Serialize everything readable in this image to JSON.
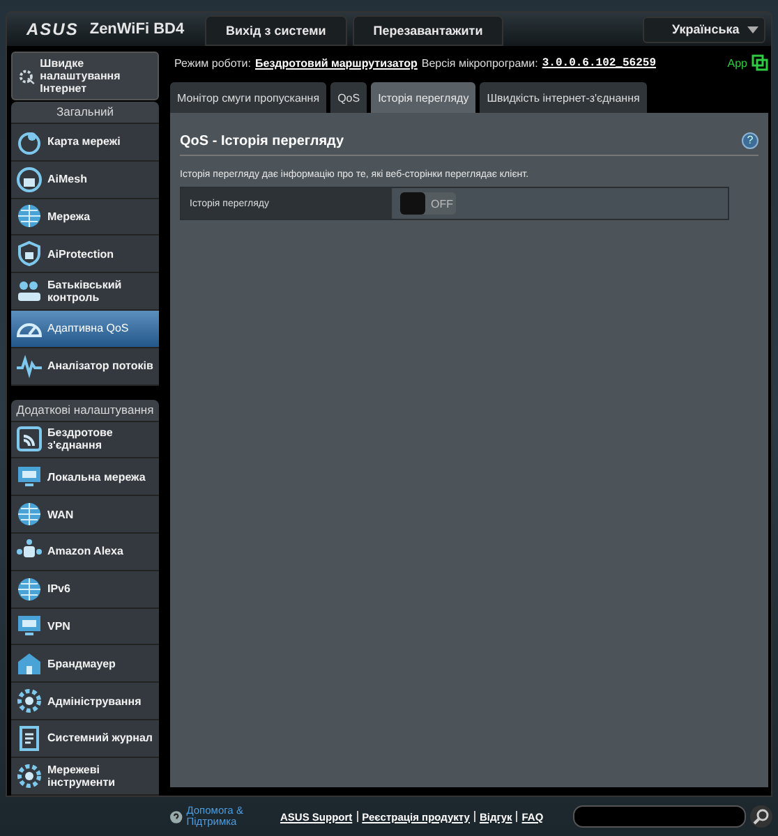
{
  "header": {
    "logo": "ASUS",
    "model": "ZenWiFi BD4",
    "buttons": [
      "Вихід з системи",
      "Перезавантажити"
    ],
    "language": "Українська"
  },
  "status": {
    "mode_label": "Режим роботи:",
    "mode": "Бездротовий маршрутизатор",
    "firmware_label": "Версія мікропрограми:",
    "firmware": "3.0.0.6.102_56259",
    "app": "App"
  },
  "quick_setup": "Швидке налаштування Інтернет",
  "sections": [
    {
      "title": "Загальний",
      "items": [
        {
          "label": "Карта мережі",
          "selected": false
        },
        {
          "label": "AiMesh",
          "selected": false
        },
        {
          "label": "Мережа",
          "selected": false
        },
        {
          "label": "AiProtection",
          "selected": false
        },
        {
          "label": "Батьківський контроль",
          "selected": false
        },
        {
          "label": "Адаптивна QoS",
          "selected": true
        },
        {
          "label": "Аналізатор потоків",
          "selected": false
        }
      ]
    },
    {
      "title": "Додаткові налаштування",
      "items": [
        {
          "label": "Бездротове з'єднання",
          "selected": false
        },
        {
          "label": "Локальна мережа",
          "selected": false
        },
        {
          "label": "WAN",
          "selected": false
        },
        {
          "label": "Amazon Alexa",
          "selected": false
        },
        {
          "label": "IPv6",
          "selected": false
        },
        {
          "label": "VPN",
          "selected": false
        },
        {
          "label": "Брандмауер",
          "selected": false
        },
        {
          "label": "Адміністрування",
          "selected": false
        },
        {
          "label": "Системний журнал",
          "selected": false
        },
        {
          "label": "Мережеві інструменти",
          "selected": false
        }
      ]
    }
  ],
  "tabs": [
    {
      "label": "Монітор смуги пропускання",
      "selected": false
    },
    {
      "label": "QoS",
      "selected": false
    },
    {
      "label": "Історія перегляду",
      "selected": true
    },
    {
      "label": "Швидкість інтернет-з'єднання",
      "selected": false
    }
  ],
  "panel": {
    "title": "QoS - Історія перегляду",
    "help": "?",
    "description": "Історія перегляду дає інформацію про те, які веб-сторінки переглядає клієнт.",
    "settings": [
      {
        "label": "Історія перегляду",
        "on": false,
        "state_text": "OFF"
      }
    ]
  },
  "footer": {
    "help": "Допомога & Підтримка",
    "links": [
      "ASUS Support",
      "Реєстрація продукту",
      "Відгук",
      "FAQ"
    ]
  }
}
